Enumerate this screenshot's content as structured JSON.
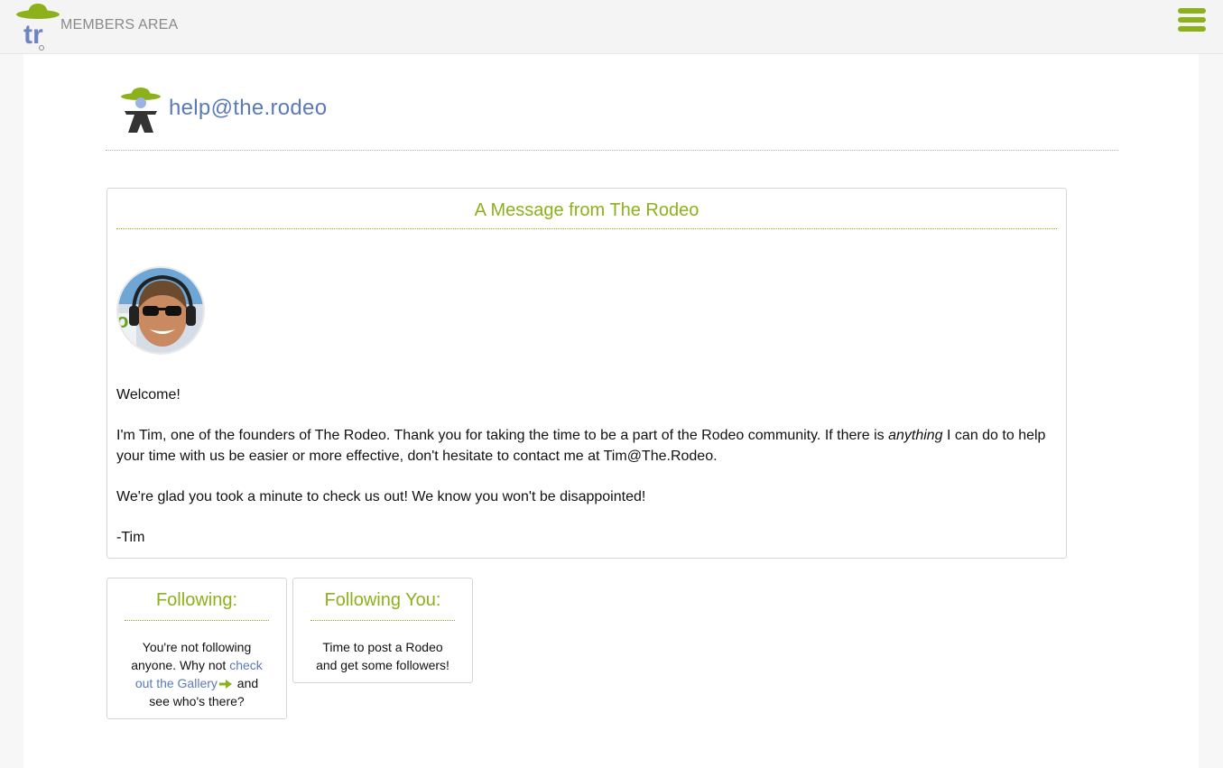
{
  "header": {
    "logo_text": "tr",
    "section_label": "MEMBERS AREA",
    "menu_icon": "hamburger-menu-icon"
  },
  "help": {
    "icon": "cowboy-helper-icon",
    "title": "help@the.rodeo"
  },
  "message": {
    "title": "A Message from The Rodeo",
    "avatar": "tim-avatar",
    "greeting": "Welcome!",
    "para1_before": "I'm Tim, one of the founders of The Rodeo. Thank you for taking the time to be a part of the Rodeo community. If there is ",
    "para1_em": "anything",
    "para1_after": " I can do to help your time with us be easier or more effective, don't hesitate to contact me at Tim@The.Rodeo.",
    "para2": "We're glad you took a minute to check us out! We know you won't be disappointed!",
    "signature": "-Tim"
  },
  "following": {
    "title": "Following:",
    "text_before": "You're not following anyone. Why not ",
    "link_text": "check out the Gallery",
    "arrow_icon": "arrow-right-icon",
    "text_after": " and see who's there?"
  },
  "following_you": {
    "title": "Following You:",
    "text": "Time to post a Rodeo and get some followers!"
  },
  "colors": {
    "accent_green": "#8db11a",
    "link_blue": "#5b7ab8"
  }
}
